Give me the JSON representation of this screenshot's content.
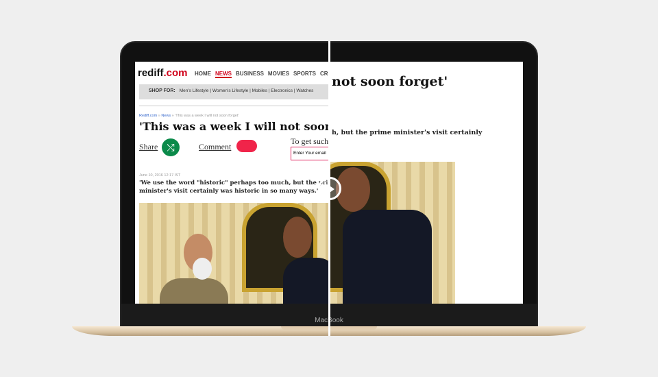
{
  "left_page": {
    "logo_main": "rediff",
    "logo_suffix": ".com",
    "nav": [
      "HOME",
      "NEWS",
      "BUSINESS",
      "MOVIES",
      "SPORTS",
      "CRI"
    ],
    "shop_label": "SHOP FOR:",
    "shop_links": "Men's Lifestyle | Women's Lifestyle | Mobiles | Electronics | Watches",
    "breadcrumb": {
      "home": "Rediff.com",
      "section": "News",
      "current": "» 'This was a week I will not soon forget'"
    },
    "headline": "'This was a week I will not soon for",
    "share_label": "Share",
    "comment_label": "Comment",
    "newsletter_prompt": "To get such a",
    "email_placeholder": "Enter Your email",
    "date": "June 10, 2016 12:17 IST",
    "lede": "'We use the word \"historic\" perhaps too much, but the prime minister's visit certainly was historic in so many ways.'"
  },
  "right_page": {
    "headline": "not soon forget'",
    "subhead": "h, but the prime minister's visit certainly"
  },
  "device_label": "MacBook"
}
